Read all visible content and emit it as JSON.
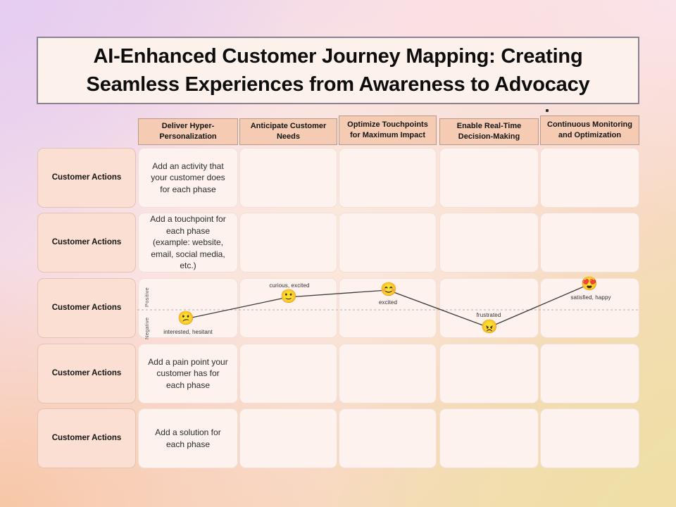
{
  "background": {
    "colors": [
      "#e6cdf1",
      "#fae3ea",
      "#f7c7a6",
      "#efdfa6"
    ]
  },
  "title": {
    "text": "AI-Enhanced Customer Journey Mapping: Creating Seamless Experiences from Awareness to Advocacy"
  },
  "theme": {
    "header_bg": "#f6cbb3",
    "cell_bg": "#fdf2ee",
    "row_label_bg": "#fbdfd2",
    "title_bg": "#fdf1ec",
    "text": "#151515"
  },
  "columns": [
    {
      "label": "Deliver Hyper-Personalization"
    },
    {
      "label": "Anticipate Customer Needs"
    },
    {
      "label": "Optimize Touchpoints for Maximum Impact"
    },
    {
      "label": "Enable Real-Time Decision-Making"
    },
    {
      "label": "Continuous Monitoring and Optimization"
    }
  ],
  "rows": [
    {
      "label": "Customer Actions",
      "first_cell": "Add an activity that your customer does for each phase"
    },
    {
      "label": "Customer Actions",
      "first_cell": "Add a touchpoint for each phase (example: website, email, social media, etc.)"
    },
    {
      "label": "Customer Actions",
      "first_cell": ""
    },
    {
      "label": "Customer Actions",
      "first_cell": "Add a pain point your customer has for each phase"
    },
    {
      "label": "Customer Actions",
      "first_cell": "Add a solution for each phase"
    }
  ],
  "emotion_chart": {
    "axis_positive": "Positive",
    "axis_negative": "Negative",
    "points": [
      {
        "emoji": "😕",
        "label": "interested, hesitant",
        "sentiment": "negative"
      },
      {
        "emoji": "🙂",
        "label": "curious, excited",
        "sentiment": "positive"
      },
      {
        "emoji": "😊",
        "label": "excited",
        "sentiment": "positive"
      },
      {
        "emoji": "😠",
        "label": "frustrated",
        "sentiment": "negative"
      },
      {
        "emoji": "😍",
        "label": "satisfied, happy",
        "sentiment": "positive"
      }
    ]
  },
  "decorations": {
    "bullet_1": "•",
    "bullet_2": "•"
  }
}
